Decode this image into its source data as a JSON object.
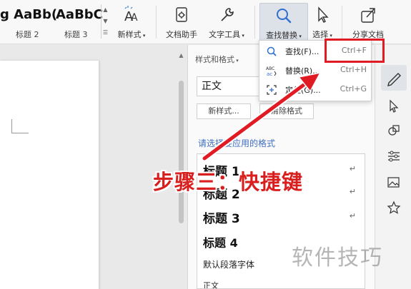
{
  "ribbon": {
    "styles": [
      {
        "sample": "g AaBb(",
        "name": "标题 2"
      },
      {
        "sample": "AaBbC",
        "name": "标题 3"
      }
    ],
    "new_style_label": "新样式",
    "doc_assistant_label": "文档助手",
    "text_tools_label": "文字工具",
    "find_replace_label": "查找替换",
    "select_label": "选择",
    "share_doc_label": "分享文档"
  },
  "pane": {
    "title": "样式和格式",
    "current_style": "正文",
    "new_style_btn": "新样式...",
    "clear_format_btn": "清除格式",
    "hint": "请选择要应用的格式",
    "styles": [
      "标题 1",
      "标题 2",
      "标题 3",
      "标题 4"
    ],
    "return_mark": "↵",
    "default_font": "默认段落字体",
    "last_item": "正文"
  },
  "dropdown": {
    "items": [
      {
        "label": "查找(F)...",
        "shortcut": "Ctrl+F"
      },
      {
        "label": "替换(R)...",
        "shortcut": "Ctrl+H"
      },
      {
        "label": "定位(G)...",
        "shortcut": "Ctrl+G"
      }
    ]
  },
  "annotation": {
    "step_text": "步骤三：快捷键",
    "watermark": "软件技巧"
  },
  "colors": {
    "accent_red": "#e01b24",
    "link_blue": "#3f6fbf"
  }
}
